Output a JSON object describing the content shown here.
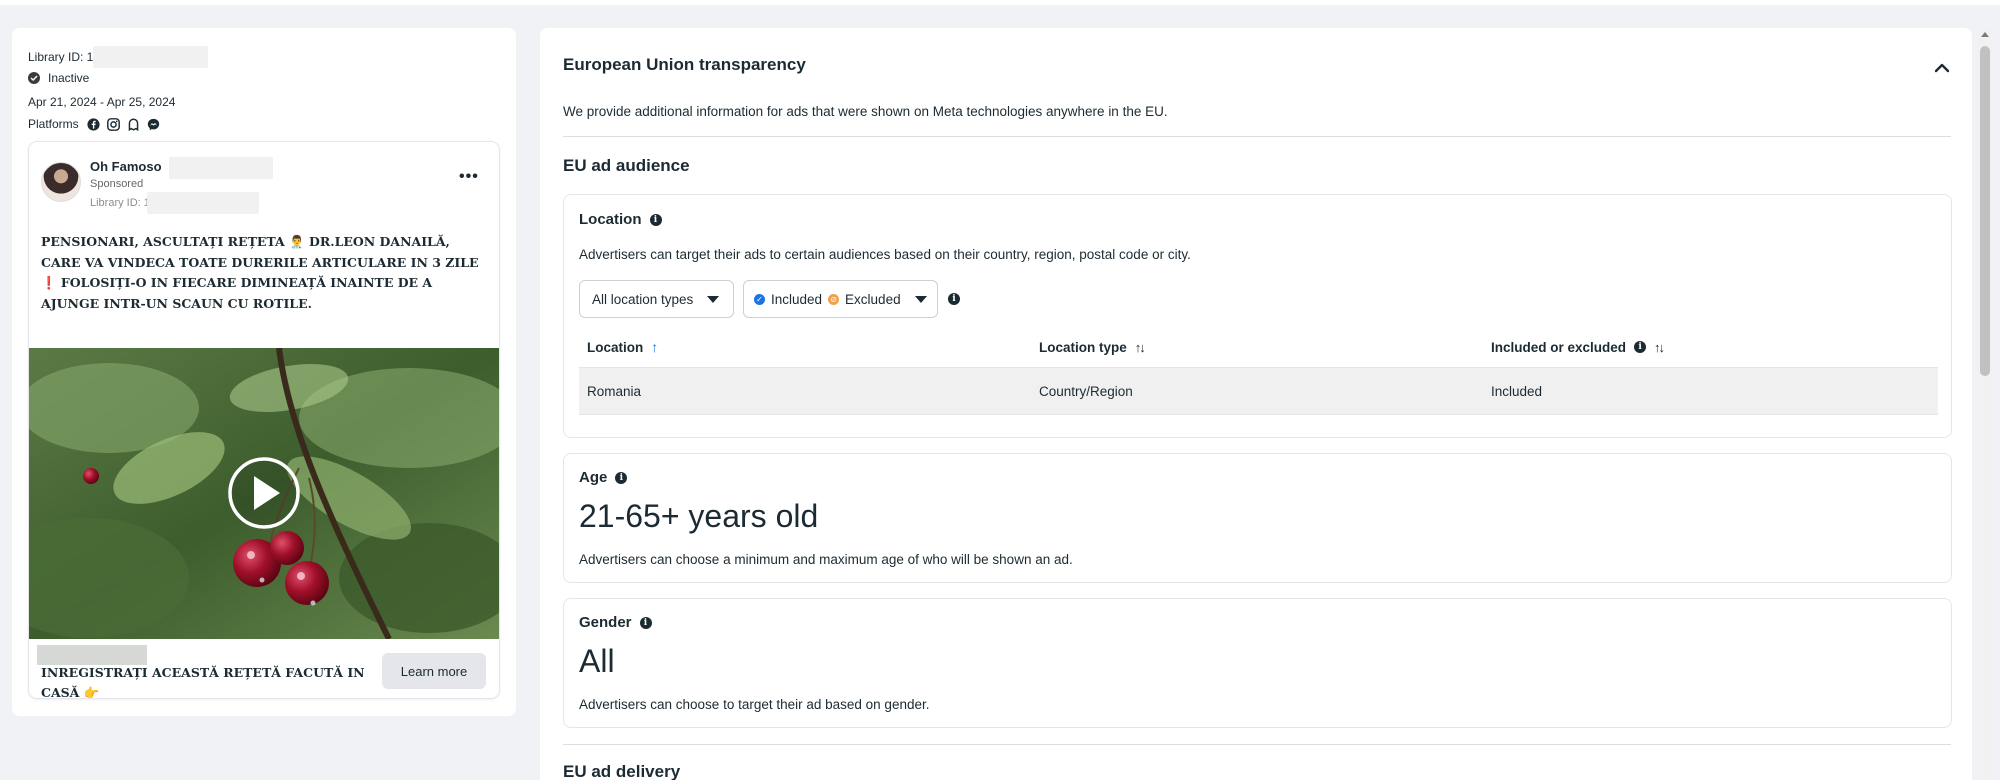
{
  "left": {
    "library_id_label": "Library ID: 1",
    "status": "Inactive",
    "date_range": "Apr 21, 2024 - Apr 25, 2024",
    "platforms_label": "Platforms",
    "platform_icons": [
      "facebook-icon",
      "instagram-icon",
      "audience-network-icon",
      "messenger-icon"
    ],
    "card": {
      "page_name": "Oh Famoso",
      "sponsored": "Sponsored",
      "library_id": "Library ID: 1",
      "more_label": "•••",
      "body_text": "PENSIONARI, ASCULTAȚI REȚETA 👨‍⚕️ DR.LEON DANAILĂ, CARE VA VINDECA TOATE DURERILE ARTICULARE IN 3 ZILE ❗ FOLOSIȚI-O IN FIECARE DIMINEAȚĂ INAINTE DE A AJUNGE INTR-UN SCAUN CU ROTILE.",
      "cta_text": "INREGISTRAȚI ACEASTĂ REȚETĂ FACUTĂ IN CASĂ 👉",
      "cta_button": "Learn more"
    }
  },
  "right": {
    "title": "European Union transparency",
    "lead": "We provide additional information for ads that were shown on Meta technologies anywhere in the EU.",
    "audience_title": "EU ad audience",
    "location": {
      "title": "Location",
      "desc": "Advertisers can target their ads to certain audiences based on their country, region, postal code or city.",
      "filter_type": "All location types",
      "filter_included": "Included",
      "filter_excluded": "Excluded",
      "columns": [
        "Location",
        "Location type",
        "Included or excluded"
      ],
      "rows": [
        {
          "location": "Romania",
          "type": "Country/Region",
          "status": "Included"
        }
      ]
    },
    "age": {
      "title": "Age",
      "value": "21-65+ years old",
      "desc": "Advertisers can choose a minimum and maximum age of who will be shown an ad."
    },
    "gender": {
      "title": "Gender",
      "value": "All",
      "desc": "Advertisers can choose to target their ad based on gender."
    },
    "delivery_title": "EU ad delivery"
  },
  "colors": {
    "background": "#f0f2f5",
    "text": "#1c2b33",
    "accent": "#1877f2",
    "included": "#1b74e4",
    "excluded": "#f0a04b"
  }
}
